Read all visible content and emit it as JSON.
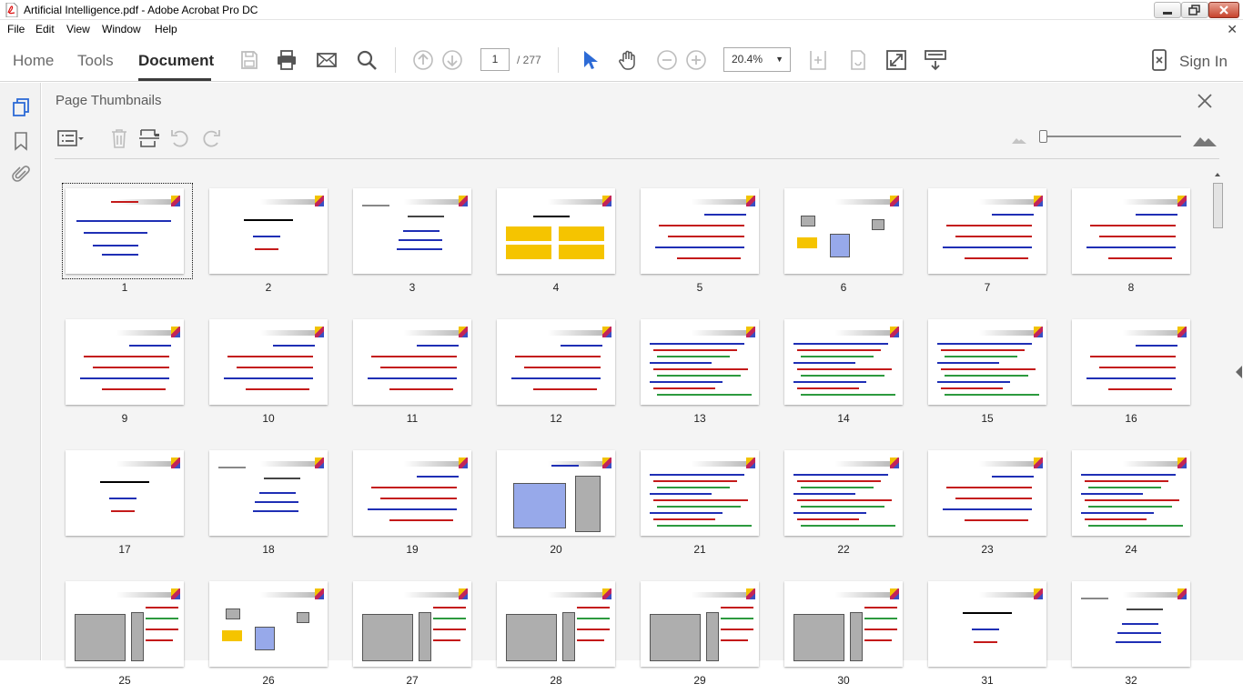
{
  "window": {
    "title": "Artificial Intelligence.pdf - Adobe Acrobat Pro DC"
  },
  "menu": [
    "File",
    "Edit",
    "View",
    "Window",
    "Help"
  ],
  "tabs": {
    "home": "Home",
    "tools": "Tools",
    "document": "Document"
  },
  "page_nav": {
    "current": "1",
    "total": "/ 277"
  },
  "zoom": "20.4%",
  "signin": "Sign In",
  "panel": {
    "title": "Page Thumbnails"
  },
  "thumbnails": [
    {
      "n": "1",
      "t": "cover"
    },
    {
      "n": "2",
      "t": "title"
    },
    {
      "n": "3",
      "t": "list"
    },
    {
      "n": "4",
      "t": "boxes"
    },
    {
      "n": "5",
      "t": "text"
    },
    {
      "n": "6",
      "t": "image"
    },
    {
      "n": "7",
      "t": "text"
    },
    {
      "n": "8",
      "t": "text"
    },
    {
      "n": "9",
      "t": "text"
    },
    {
      "n": "10",
      "t": "text"
    },
    {
      "n": "11",
      "t": "text"
    },
    {
      "n": "12",
      "t": "text"
    },
    {
      "n": "13",
      "t": "dense"
    },
    {
      "n": "14",
      "t": "dense"
    },
    {
      "n": "15",
      "t": "dense"
    },
    {
      "n": "16",
      "t": "text"
    },
    {
      "n": "17",
      "t": "title"
    },
    {
      "n": "18",
      "t": "list"
    },
    {
      "n": "19",
      "t": "text"
    },
    {
      "n": "20",
      "t": "diagram"
    },
    {
      "n": "21",
      "t": "dense"
    },
    {
      "n": "22",
      "t": "dense"
    },
    {
      "n": "23",
      "t": "text"
    },
    {
      "n": "24",
      "t": "dense"
    },
    {
      "n": "25",
      "t": "diagram2"
    },
    {
      "n": "26",
      "t": "image"
    },
    {
      "n": "27",
      "t": "diagram2"
    },
    {
      "n": "28",
      "t": "diagram2"
    },
    {
      "n": "29",
      "t": "diagram2"
    },
    {
      "n": "30",
      "t": "diagram2"
    },
    {
      "n": "31",
      "t": "title"
    },
    {
      "n": "32",
      "t": "list"
    }
  ]
}
